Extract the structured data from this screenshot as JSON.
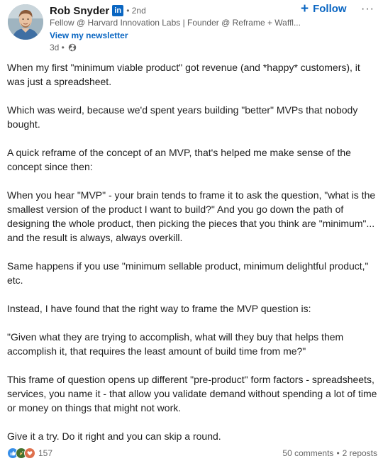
{
  "author": {
    "name": "Rob Snyder",
    "badge": "in",
    "degree": "• 2nd",
    "headline": "Fellow @ Harvard Innovation Labs | Founder @ Reframe + Waffl...",
    "newsletter_link": "View my newsletter",
    "time_posted": "3d •",
    "visibility_icon": "globe-icon"
  },
  "actions": {
    "follow_label": "Follow",
    "follow_icon": "+",
    "more_icon": "···"
  },
  "post": {
    "paragraphs": [
      "When my first \"minimum viable product\" got revenue (and *happy* customers), it was just a spreadsheet.",
      "Which was weird, because we'd spent years building \"better\" MVPs that nobody bought.",
      "A quick reframe of the concept of an MVP, that's helped me make sense of the concept since then:",
      "When you hear \"MVP\" - your brain tends to frame it to ask the question, \"what is the smallest version of the product I want to build?\" And you go down the path of designing the whole product, then picking the pieces that you think are \"minimum\"... and the result is always, always overkill.",
      "Same happens if you use \"minimum sellable product, minimum delightful product,\" etc.",
      "Instead, I have found that the right way to frame the MVP question is:",
      "\"Given what they are trying to accomplish, what will they buy that helps them accomplish it, that requires the least amount of build time from me?\"",
      "This frame of question opens up different \"pre-product\" form factors - spreadsheets, services, you name it - that allow you validate demand without spending a lot of time or money on things that might not work.",
      "Give it a try. Do it right and you can skip a round."
    ]
  },
  "footer": {
    "reaction_icons": [
      "like-icon",
      "celebrate-icon",
      "love-icon"
    ],
    "reaction_count": "157",
    "comments": "50 comments",
    "separator": "•",
    "reposts": "2 reposts"
  },
  "colors": {
    "accent": "#0a66c2",
    "muted": "#666666",
    "text": "#1d1d1d"
  }
}
